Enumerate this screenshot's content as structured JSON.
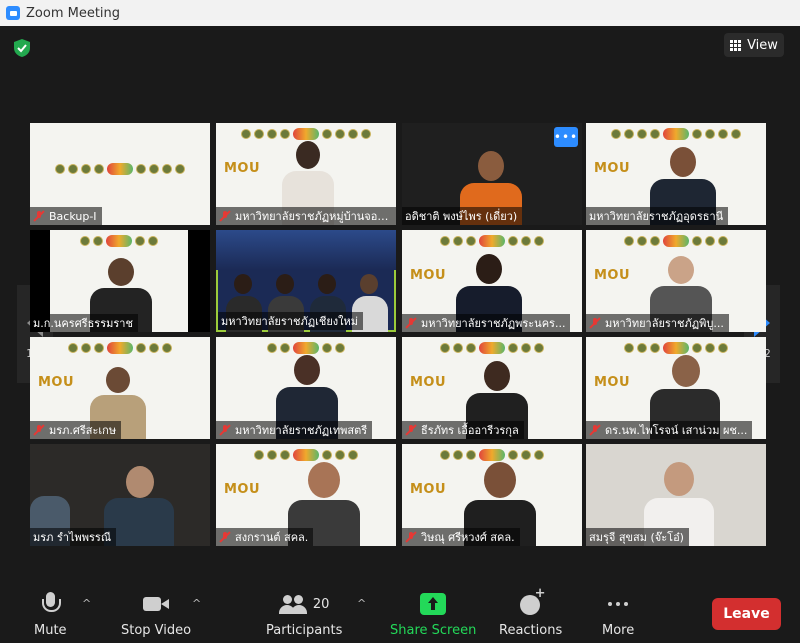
{
  "window": {
    "title": "Zoom Meeting"
  },
  "view": {
    "label": "View"
  },
  "pagination": {
    "current": "1/2"
  },
  "tiles": [
    {
      "name": "Backup-I"
    },
    {
      "name": "มหาวิทยาลัยราชภัฏหมู่บ้านจอม..."
    },
    {
      "name": "อดิชาติ พงษ์ไพร (เดี่ยว)"
    },
    {
      "name": "มหาวิทยาลัยราชภัฏอุดรธานี"
    },
    {
      "name": "ม.ก.นครศรีธรรมราช"
    },
    {
      "name": "มหาวิทยาลัยราชภัฏเชียงใหม่"
    },
    {
      "name": "มหาวิทยาลัยราชภัฏพระนคร..."
    },
    {
      "name": "มหาวิทยาลัยราชภัฏพิบู..."
    },
    {
      "name": "มรภ.ศรีสะเกษ"
    },
    {
      "name": "มหาวิทยาลัยราชภัฏเทพสตรี"
    },
    {
      "name": "ธีรภัทร เอื้ออารีวรกุล"
    },
    {
      "name": "ดร.นพ.ไพโรจน์ เสาน่วม ผช..."
    },
    {
      "name": "มรภ รำไพพรรณี"
    },
    {
      "name": "สงกรานต์ สคล."
    },
    {
      "name": "วิษณุ ศรีหวงศ์ สคล."
    },
    {
      "name": "สมรุจี สุขสม (จ๊ะโอ๋)"
    }
  ],
  "mou_text": "MOU",
  "more_dots": "•••",
  "toolbar": {
    "mute": "Mute",
    "stop_video": "Stop Video",
    "participants": "Participants",
    "participants_count": "20",
    "share_screen": "Share Screen",
    "reactions": "Reactions",
    "more": "More",
    "leave": "Leave",
    "caret": "^"
  },
  "colors": {
    "accent_blue": "#2d8cff",
    "share_green": "#23d959",
    "leave_red": "#d32f2f",
    "active_speaker": "#9ccc3b"
  }
}
